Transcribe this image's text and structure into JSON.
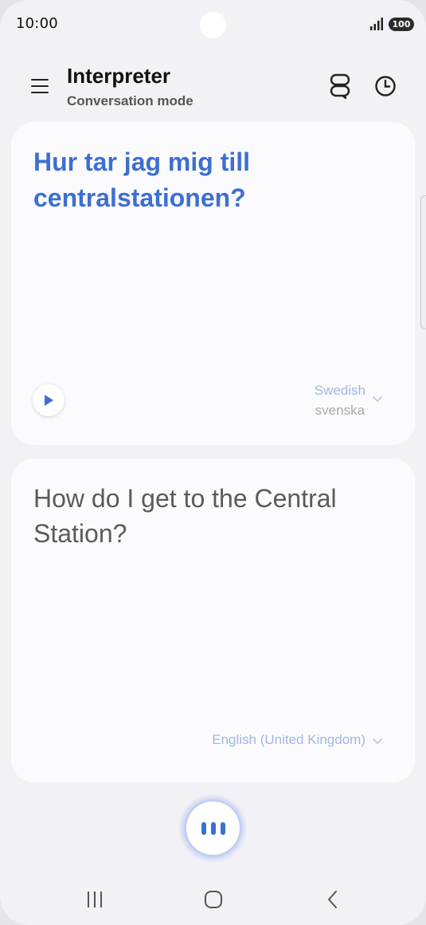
{
  "status_bar": {
    "time": "10:00",
    "battery": "100",
    "icons": [
      "signal-icon",
      "battery-icon"
    ]
  },
  "header": {
    "title": "Interpreter",
    "subtitle": "Conversation mode",
    "icons": [
      "menu-icon",
      "conversation-mode-icon",
      "history-icon"
    ]
  },
  "source_card": {
    "text": "Hur tar jag mig till centralstationen?",
    "language": "Swedish",
    "language_native": "svenska",
    "icons": [
      "play-icon",
      "chevron-down-icon"
    ]
  },
  "target_card": {
    "text": "How do I get to the Central Station?",
    "language": "English (United Kingdom)",
    "icons": [
      "chevron-down-icon"
    ]
  },
  "mic": {
    "icon": "voice-wave-icon"
  },
  "nav": {
    "icons": [
      "recents-icon",
      "home-icon",
      "back-icon"
    ]
  },
  "colors": {
    "accent": "#3d6fd1",
    "background": "#f2f2f6",
    "card": "#fbfbfd",
    "language_label": "#9fb7e3"
  }
}
